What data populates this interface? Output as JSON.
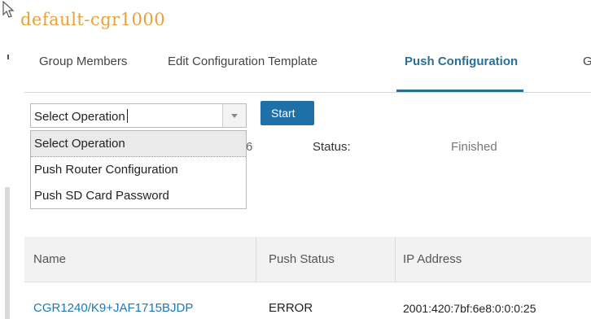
{
  "page": {
    "title": "default-cgr1000"
  },
  "tabs": [
    {
      "label": "Group Members"
    },
    {
      "label": "Edit Configuration Template"
    },
    {
      "label": "Push Configuration",
      "active": true
    },
    {
      "label": "G"
    }
  ],
  "operation": {
    "selected_value": "Select Operation",
    "options": [
      "Select Operation",
      "Push Router Configuration",
      "Push SD Card Password"
    ],
    "start_label": "Start"
  },
  "summary": {
    "count_fragment": "6",
    "status_label": "Status:",
    "status_value": "Finished"
  },
  "table": {
    "columns": [
      "Name",
      "Push Status",
      "IP Address"
    ],
    "rows": [
      [
        "CGR1240/K9+JAF1715BJDP",
        "ERROR",
        "2001:420:7bf:6e8:0:0:0:25"
      ]
    ]
  },
  "colors": {
    "accent": "#2a6f97",
    "title": "#e8a23c",
    "button": "#1f6fa8",
    "link": "#1f78b4"
  }
}
